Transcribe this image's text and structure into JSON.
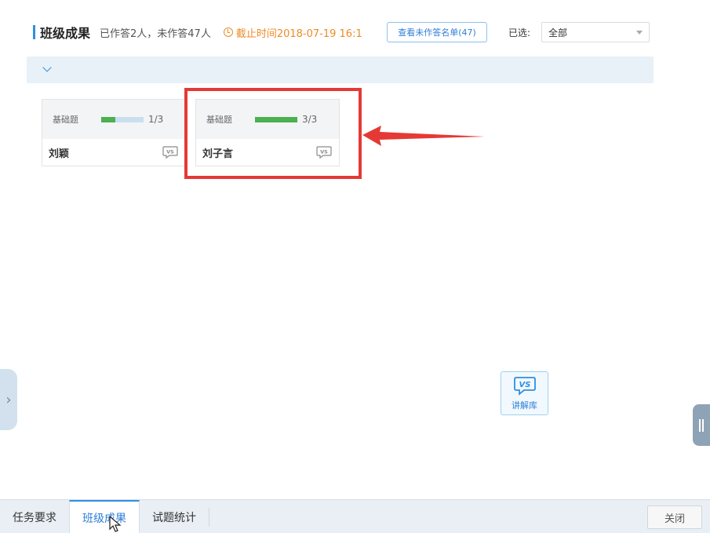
{
  "header": {
    "title": "班级成果",
    "stats": "已作答2人，未作答47人",
    "deadline": "截止时间2018-07-19 16:1",
    "unanswered_button": "查看未作答名单(47)",
    "selected_label": "已选:",
    "select_value": "全部"
  },
  "cards": [
    {
      "category": "基础题",
      "progress": "1/3",
      "progress_fraction": 0.33,
      "name": "刘颖"
    },
    {
      "category": "基础题",
      "progress": "3/3",
      "progress_fraction": 1.0,
      "name": "刘子言"
    }
  ],
  "vs_icon_text": "VS",
  "knowledge_base": {
    "label": "讲解库"
  },
  "tabs": [
    {
      "label": "任务要求",
      "active": false
    },
    {
      "label": "班级成果",
      "active": true
    },
    {
      "label": "试题统计",
      "active": false
    }
  ],
  "close_button": "关闭",
  "colors": {
    "accent": "#2f8fe0",
    "deadline": "#f08a24",
    "progress": "#4caf50",
    "highlight": "#e53935"
  }
}
